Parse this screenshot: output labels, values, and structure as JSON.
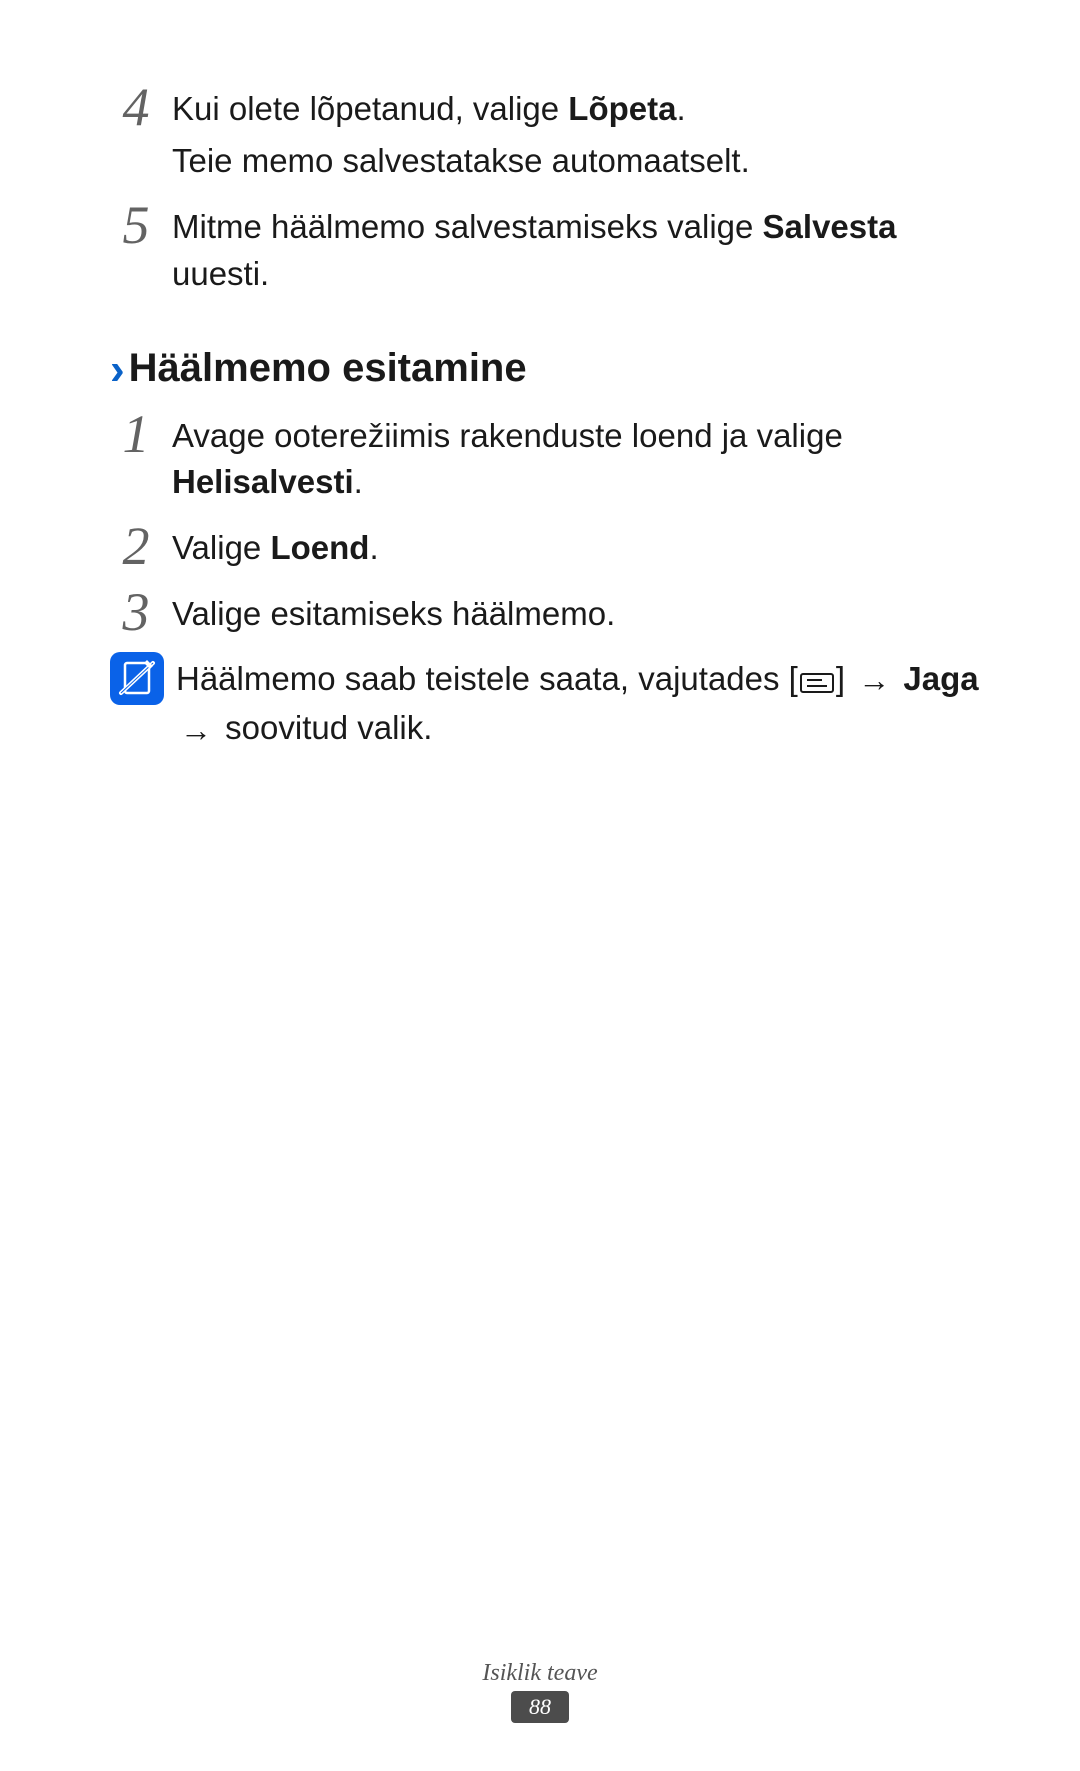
{
  "steps_top": [
    {
      "num": "4",
      "lines": [
        [
          {
            "t": "Kui olete lõpetanud, valige "
          },
          {
            "t": "Lõpeta",
            "b": true
          },
          {
            "t": "."
          }
        ],
        [
          {
            "t": "Teie memo salvestatakse automaatselt."
          }
        ]
      ]
    },
    {
      "num": "5",
      "lines": [
        [
          {
            "t": "Mitme häälmemo salvestamiseks valige "
          },
          {
            "t": "Salvesta",
            "b": true
          },
          {
            "t": " uuesti."
          }
        ]
      ]
    }
  ],
  "heading": "Häälmemo esitamine",
  "steps_main": [
    {
      "num": "1",
      "lines": [
        [
          {
            "t": "Avage ooterežiimis rakenduste loend ja valige "
          },
          {
            "t": "Helisalvesti",
            "b": true
          },
          {
            "t": "."
          }
        ]
      ]
    },
    {
      "num": "2",
      "lines": [
        [
          {
            "t": "Valige "
          },
          {
            "t": "Loend",
            "b": true
          },
          {
            "t": "."
          }
        ]
      ]
    },
    {
      "num": "3",
      "lines": [
        [
          {
            "t": "Valige esitamiseks häälmemo."
          }
        ]
      ]
    }
  ],
  "note": {
    "pre": "Häälmemo saab teistele saata, vajutades [",
    "post_bracket": "] ",
    "jaga": "Jaga",
    "tail": "soovitud valik."
  },
  "footer": {
    "section": "Isiklik teave",
    "page": "88"
  }
}
